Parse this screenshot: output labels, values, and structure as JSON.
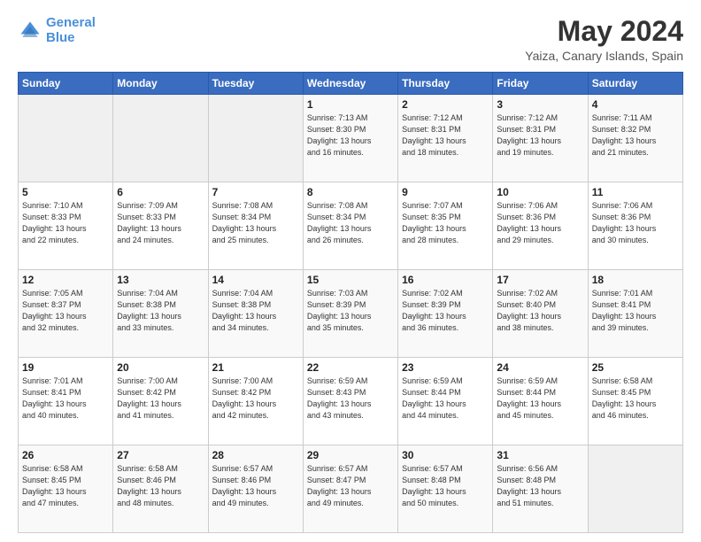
{
  "header": {
    "logo_line1": "General",
    "logo_line2": "Blue",
    "month": "May 2024",
    "location": "Yaiza, Canary Islands, Spain"
  },
  "weekdays": [
    "Sunday",
    "Monday",
    "Tuesday",
    "Wednesday",
    "Thursday",
    "Friday",
    "Saturday"
  ],
  "weeks": [
    [
      {
        "day": "",
        "info": ""
      },
      {
        "day": "",
        "info": ""
      },
      {
        "day": "",
        "info": ""
      },
      {
        "day": "1",
        "info": "Sunrise: 7:13 AM\nSunset: 8:30 PM\nDaylight: 13 hours\nand 16 minutes."
      },
      {
        "day": "2",
        "info": "Sunrise: 7:12 AM\nSunset: 8:31 PM\nDaylight: 13 hours\nand 18 minutes."
      },
      {
        "day": "3",
        "info": "Sunrise: 7:12 AM\nSunset: 8:31 PM\nDaylight: 13 hours\nand 19 minutes."
      },
      {
        "day": "4",
        "info": "Sunrise: 7:11 AM\nSunset: 8:32 PM\nDaylight: 13 hours\nand 21 minutes."
      }
    ],
    [
      {
        "day": "5",
        "info": "Sunrise: 7:10 AM\nSunset: 8:33 PM\nDaylight: 13 hours\nand 22 minutes."
      },
      {
        "day": "6",
        "info": "Sunrise: 7:09 AM\nSunset: 8:33 PM\nDaylight: 13 hours\nand 24 minutes."
      },
      {
        "day": "7",
        "info": "Sunrise: 7:08 AM\nSunset: 8:34 PM\nDaylight: 13 hours\nand 25 minutes."
      },
      {
        "day": "8",
        "info": "Sunrise: 7:08 AM\nSunset: 8:34 PM\nDaylight: 13 hours\nand 26 minutes."
      },
      {
        "day": "9",
        "info": "Sunrise: 7:07 AM\nSunset: 8:35 PM\nDaylight: 13 hours\nand 28 minutes."
      },
      {
        "day": "10",
        "info": "Sunrise: 7:06 AM\nSunset: 8:36 PM\nDaylight: 13 hours\nand 29 minutes."
      },
      {
        "day": "11",
        "info": "Sunrise: 7:06 AM\nSunset: 8:36 PM\nDaylight: 13 hours\nand 30 minutes."
      }
    ],
    [
      {
        "day": "12",
        "info": "Sunrise: 7:05 AM\nSunset: 8:37 PM\nDaylight: 13 hours\nand 32 minutes."
      },
      {
        "day": "13",
        "info": "Sunrise: 7:04 AM\nSunset: 8:38 PM\nDaylight: 13 hours\nand 33 minutes."
      },
      {
        "day": "14",
        "info": "Sunrise: 7:04 AM\nSunset: 8:38 PM\nDaylight: 13 hours\nand 34 minutes."
      },
      {
        "day": "15",
        "info": "Sunrise: 7:03 AM\nSunset: 8:39 PM\nDaylight: 13 hours\nand 35 minutes."
      },
      {
        "day": "16",
        "info": "Sunrise: 7:02 AM\nSunset: 8:39 PM\nDaylight: 13 hours\nand 36 minutes."
      },
      {
        "day": "17",
        "info": "Sunrise: 7:02 AM\nSunset: 8:40 PM\nDaylight: 13 hours\nand 38 minutes."
      },
      {
        "day": "18",
        "info": "Sunrise: 7:01 AM\nSunset: 8:41 PM\nDaylight: 13 hours\nand 39 minutes."
      }
    ],
    [
      {
        "day": "19",
        "info": "Sunrise: 7:01 AM\nSunset: 8:41 PM\nDaylight: 13 hours\nand 40 minutes."
      },
      {
        "day": "20",
        "info": "Sunrise: 7:00 AM\nSunset: 8:42 PM\nDaylight: 13 hours\nand 41 minutes."
      },
      {
        "day": "21",
        "info": "Sunrise: 7:00 AM\nSunset: 8:42 PM\nDaylight: 13 hours\nand 42 minutes."
      },
      {
        "day": "22",
        "info": "Sunrise: 6:59 AM\nSunset: 8:43 PM\nDaylight: 13 hours\nand 43 minutes."
      },
      {
        "day": "23",
        "info": "Sunrise: 6:59 AM\nSunset: 8:44 PM\nDaylight: 13 hours\nand 44 minutes."
      },
      {
        "day": "24",
        "info": "Sunrise: 6:59 AM\nSunset: 8:44 PM\nDaylight: 13 hours\nand 45 minutes."
      },
      {
        "day": "25",
        "info": "Sunrise: 6:58 AM\nSunset: 8:45 PM\nDaylight: 13 hours\nand 46 minutes."
      }
    ],
    [
      {
        "day": "26",
        "info": "Sunrise: 6:58 AM\nSunset: 8:45 PM\nDaylight: 13 hours\nand 47 minutes."
      },
      {
        "day": "27",
        "info": "Sunrise: 6:58 AM\nSunset: 8:46 PM\nDaylight: 13 hours\nand 48 minutes."
      },
      {
        "day": "28",
        "info": "Sunrise: 6:57 AM\nSunset: 8:46 PM\nDaylight: 13 hours\nand 49 minutes."
      },
      {
        "day": "29",
        "info": "Sunrise: 6:57 AM\nSunset: 8:47 PM\nDaylight: 13 hours\nand 49 minutes."
      },
      {
        "day": "30",
        "info": "Sunrise: 6:57 AM\nSunset: 8:48 PM\nDaylight: 13 hours\nand 50 minutes."
      },
      {
        "day": "31",
        "info": "Sunrise: 6:56 AM\nSunset: 8:48 PM\nDaylight: 13 hours\nand 51 minutes."
      },
      {
        "day": "",
        "info": ""
      }
    ]
  ]
}
